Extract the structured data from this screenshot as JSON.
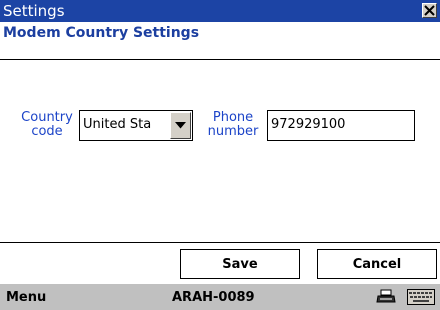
{
  "window": {
    "title": "Settings",
    "close_icon": "close-icon"
  },
  "header": {
    "subtitle": "Modem Country Settings"
  },
  "form": {
    "country_label_line1": "Country",
    "country_label_line2": "code",
    "country_value": "United Sta",
    "phone_label_line1": "Phone",
    "phone_label_line2": "number",
    "phone_value": "972929100"
  },
  "buttons": {
    "save_label": "Save",
    "cancel_label": "Cancel"
  },
  "menubar": {
    "menu_label": "Menu",
    "device_name": "ARAH-0089",
    "icons": [
      "printer-icon",
      "keyboard-icon"
    ]
  },
  "colors": {
    "titlebar": "#1c44a5",
    "label_blue": "#1c44c8",
    "menubar": "#c0c0c0"
  }
}
